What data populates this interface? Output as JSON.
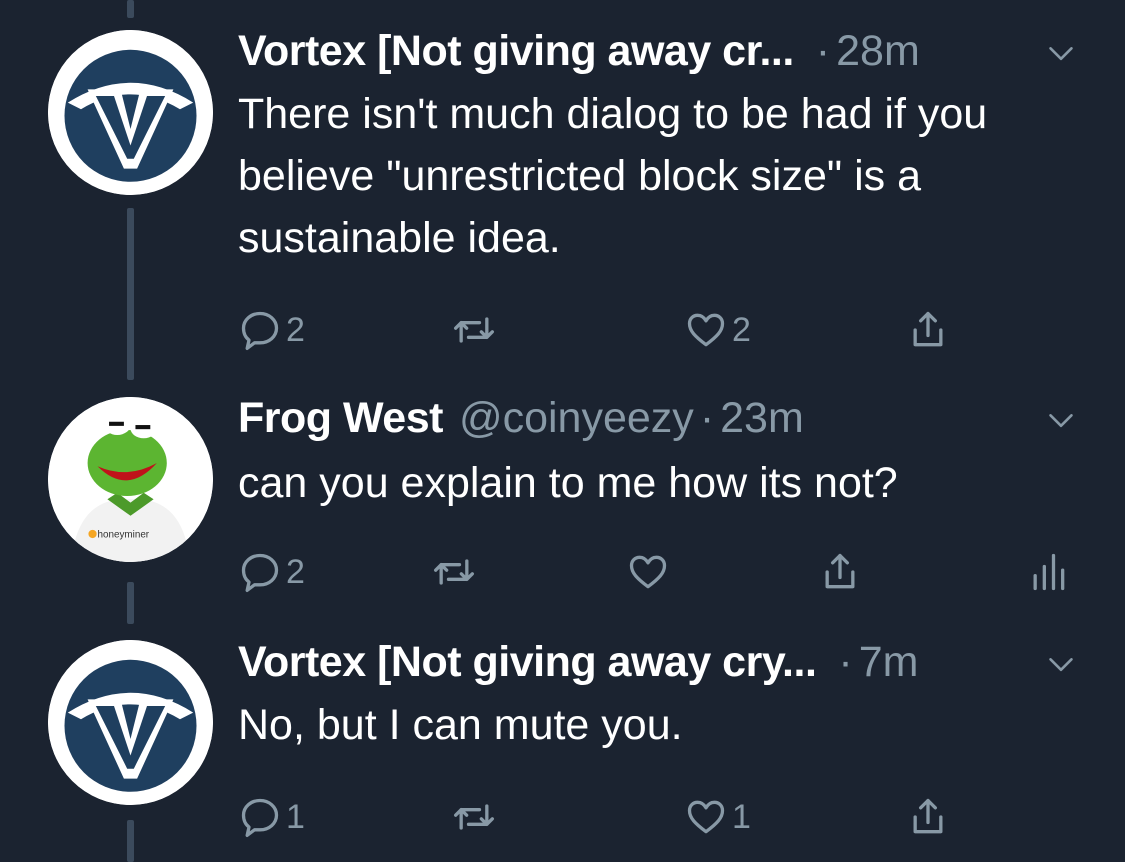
{
  "colors": {
    "background": "#1b2330",
    "text": "#ffffff",
    "muted": "#8899a6",
    "thread_line": "#3b4a5c"
  },
  "tweets": [
    {
      "name": "Vortex [Not giving away cr...",
      "handle": "",
      "dot": "·",
      "time": "28m",
      "text": "There isn't much dialog to be had if you believe \"unrestricted block size\" is a sustainable idea.",
      "avatar_icon": "vortex-logo",
      "replies": "2",
      "retweets": "",
      "likes": "2"
    },
    {
      "name": "Frog West",
      "handle": "@coinyeezy",
      "dot": "·",
      "time": "23m",
      "text": "can you explain to me how its not?",
      "avatar_icon": "kermit-frog",
      "avatar_label": "honeyminer",
      "replies": "2",
      "retweets": "",
      "likes": ""
    },
    {
      "name": "Vortex [Not giving away cry...",
      "handle": "",
      "dot": "·",
      "time": "7m",
      "text": "No, but I can mute you.",
      "avatar_icon": "vortex-logo",
      "replies": "1",
      "retweets": "",
      "likes": "1"
    }
  ]
}
